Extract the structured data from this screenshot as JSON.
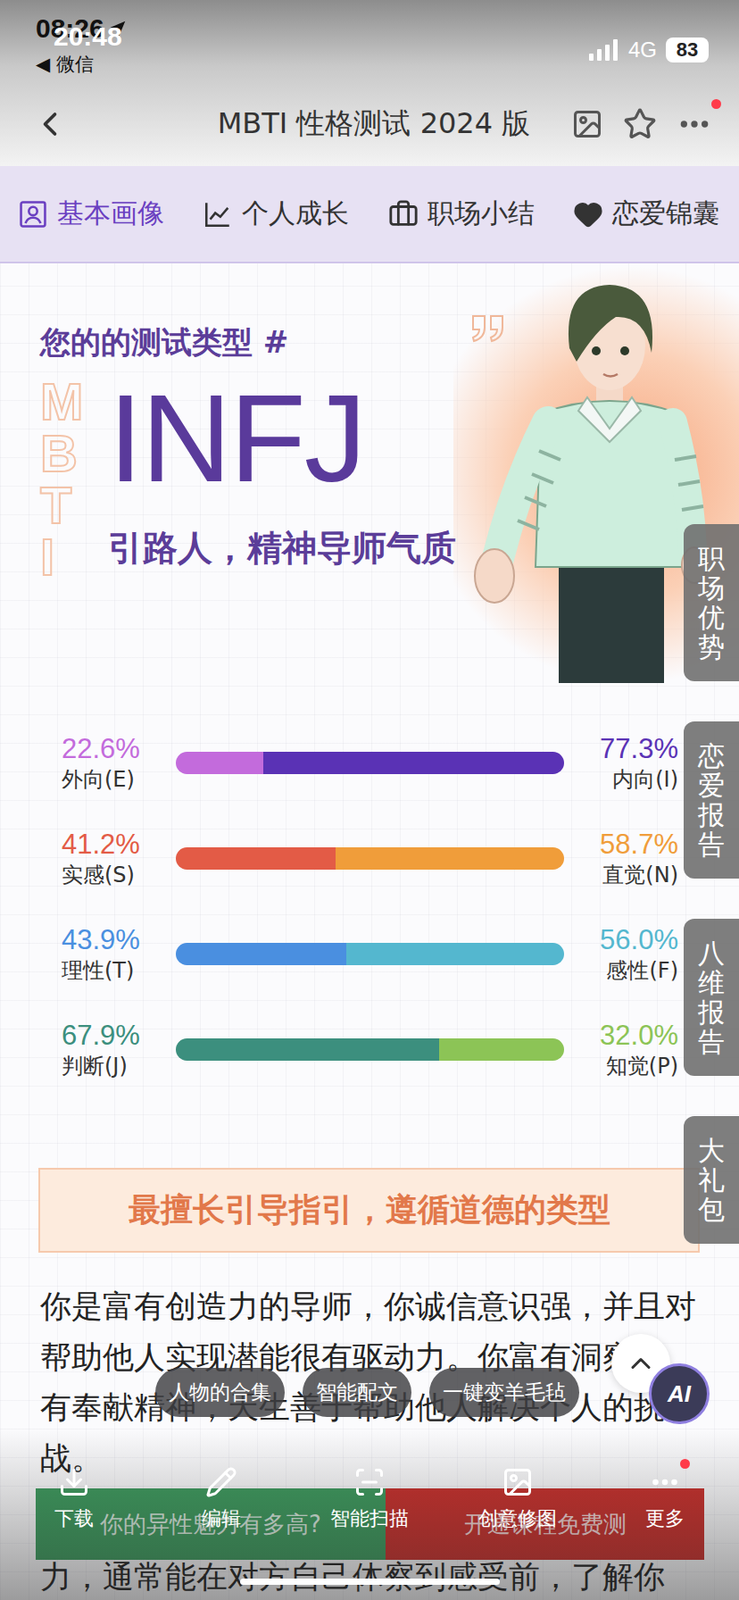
{
  "status_bar": {
    "time_under": "08:26",
    "time_over": "20:48",
    "back_app": "◀ 微信",
    "network": "4G",
    "battery": "83"
  },
  "nav": {
    "title": "MBTI 性格测试 2024 版",
    "more_badge": true
  },
  "tabs": [
    {
      "label": "基本画像",
      "selected": true
    },
    {
      "label": "个人成长",
      "selected": false
    },
    {
      "label": "职场小结",
      "selected": false
    },
    {
      "label": "恋爱锦囊",
      "selected": false
    }
  ],
  "hero": {
    "heading": "您的的测试类型 #",
    "watermark": "MBTI",
    "type_code": "INFJ",
    "subtitle": "引路人，精神导师气质"
  },
  "dimensions": [
    {
      "left_label": "外向(E)",
      "left_pct": "22.6%",
      "left_color": "#c36bdc",
      "right_label": "内向(I)",
      "right_pct": "77.3%",
      "right_color": "#5a32b5",
      "level": 0.226
    },
    {
      "left_label": "实感(S)",
      "left_pct": "41.2%",
      "left_color": "#e35b46",
      "right_label": "直觉(N)",
      "right_pct": "58.7%",
      "right_color": "#f09d3a",
      "level": 0.412
    },
    {
      "left_label": "理性(T)",
      "left_pct": "43.9%",
      "left_color": "#4a8fe0",
      "right_label": "感性(F)",
      "right_pct": "56.0%",
      "right_color": "#54b7cf",
      "level": 0.439
    },
    {
      "left_label": "判断(J)",
      "left_pct": "67.9%",
      "left_color": "#3c8f7e",
      "right_label": "知觉(P)",
      "right_pct": "32.0%",
      "right_color": "#8cc456",
      "level": 0.679
    }
  ],
  "side_tabs": [
    "职场优势",
    "恋爱报告",
    "八维报告",
    "大礼包"
  ],
  "banner": "最擅长引导指引，遵循道德的类型",
  "paragraphs": [
    "你是富有创造力的导师，你诚信意识强，并且对帮助他人实现潜能很有驱动力。你富有洞察力，有奉献精神，天生善于帮助他人解决个人的挑战。",
    "力，通常能在对方自己体察到感受前，了解你"
  ],
  "promo_buttons": [
    {
      "label": "你的异性魅力有多高?",
      "color": "#3d9b5e"
    },
    {
      "label": "开通课程免费测",
      "color": "#c9302c"
    }
  ],
  "floating_chips": [
    "人物的合集",
    "智能配文",
    "一键变羊毛毡"
  ],
  "ai_button": "AI",
  "toolbar": [
    {
      "label": "下载",
      "badge": false
    },
    {
      "label": "编辑",
      "badge": false
    },
    {
      "label": "智能扫描",
      "badge": false
    },
    {
      "label": "创意修图",
      "badge": false
    },
    {
      "label": "更多",
      "badge": true
    }
  ]
}
